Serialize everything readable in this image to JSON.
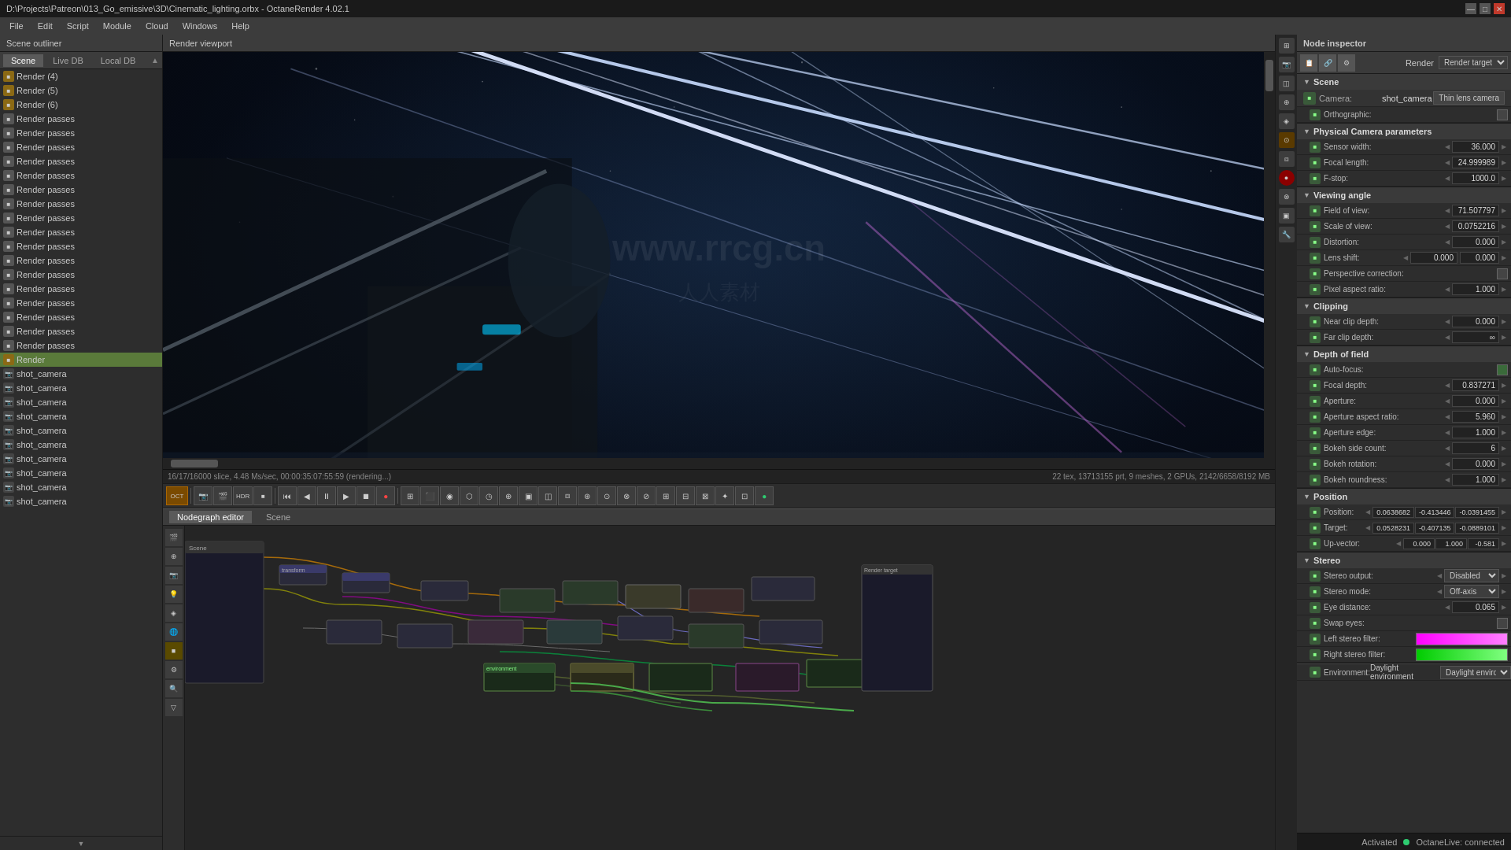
{
  "titlebar": {
    "title": "D:\\Projects\\Patreon\\013_Go_emissive\\3D\\Cinematic_lighting.orbx - OctaneRender 4.02.1",
    "minimize": "—",
    "maximize": "□",
    "close": "✕"
  },
  "menubar": {
    "items": [
      "File",
      "Edit",
      "Script",
      "Module",
      "Cloud",
      "Windows",
      "Help"
    ]
  },
  "left_panel": {
    "header": "Scene outliner",
    "tabs": [
      "Scene",
      "Live DB",
      "Local DB"
    ],
    "active_tab": "Scene",
    "items": [
      {
        "type": "render",
        "name": "Render (4)",
        "level": 1
      },
      {
        "type": "render",
        "name": "Render (5)",
        "level": 1
      },
      {
        "type": "render",
        "name": "Render (6)",
        "level": 1
      },
      {
        "type": "render",
        "name": "Render passes",
        "level": 1
      },
      {
        "type": "render",
        "name": "Render passes",
        "level": 1
      },
      {
        "type": "render",
        "name": "Render passes",
        "level": 1
      },
      {
        "type": "render",
        "name": "Render passes",
        "level": 1
      },
      {
        "type": "render",
        "name": "Render passes",
        "level": 1
      },
      {
        "type": "render",
        "name": "Render passes",
        "level": 1
      },
      {
        "type": "render",
        "name": "Render passes",
        "level": 1
      },
      {
        "type": "render",
        "name": "Render passes",
        "level": 1
      },
      {
        "type": "render",
        "name": "Render passes",
        "level": 1
      },
      {
        "type": "render",
        "name": "Render passes",
        "level": 1
      },
      {
        "type": "render",
        "name": "Render passes",
        "level": 1
      },
      {
        "type": "render",
        "name": "Render passes",
        "level": 1
      },
      {
        "type": "render",
        "name": "Render passes",
        "level": 1
      },
      {
        "type": "render",
        "name": "Render passes",
        "level": 1
      },
      {
        "type": "render",
        "name": "Render passes",
        "level": 1
      },
      {
        "type": "render",
        "name": "Render passes",
        "level": 1
      },
      {
        "type": "render",
        "name": "Render passes",
        "level": 1
      },
      {
        "type": "render",
        "name": "Render passes",
        "level": 1
      },
      {
        "type": "render",
        "name": "Render",
        "level": 1,
        "selected": true
      },
      {
        "type": "camera",
        "name": "shot_camera",
        "level": 1
      },
      {
        "type": "camera",
        "name": "shot_camera",
        "level": 1
      },
      {
        "type": "camera",
        "name": "shot_camera",
        "level": 1
      },
      {
        "type": "camera",
        "name": "shot_camera",
        "level": 1
      },
      {
        "type": "camera",
        "name": "shot_camera",
        "level": 1
      },
      {
        "type": "camera",
        "name": "shot_camera",
        "level": 1
      },
      {
        "type": "camera",
        "name": "shot_camera",
        "level": 1
      },
      {
        "type": "camera",
        "name": "shot_camera",
        "level": 1
      },
      {
        "type": "camera",
        "name": "shot_camera",
        "level": 1
      },
      {
        "type": "camera",
        "name": "shot_camera",
        "level": 1
      },
      {
        "type": "camera",
        "name": "shot_camera",
        "level": 1
      }
    ]
  },
  "render_viewport": {
    "header": "Render viewport",
    "status_left": "16/17/16000 slice, 4.48 Ms/sec, 00:00:35:07:55:59 (rendering...)",
    "status_right": "22 tex, 13713155 prt, 9 meshes, 2 GPUs, 2142/6658/8192 MB"
  },
  "render_toolbar": {
    "time_display": "16/17/16000",
    "buttons": [
      "play_back",
      "prev_frame",
      "play_pause",
      "next_frame",
      "stop",
      "record",
      "camera",
      "render",
      "pause",
      "settings1",
      "settings2",
      "settings3",
      "settings4",
      "settings5",
      "timeline",
      "curve",
      "graph",
      "transform1",
      "transform2",
      "snap",
      "grid",
      "viewport_options",
      "color",
      "indicator"
    ]
  },
  "nodegraph": {
    "header": "Nodegraph editor",
    "tabs": [
      "Nodegraph editor",
      "Scene"
    ]
  },
  "node_inspector": {
    "header": "Node inspector",
    "render_label": "Render",
    "render_target_label": "Render target",
    "render_target_value": "Render target",
    "scene_section": {
      "title": "Scene",
      "camera_label": "Camera:",
      "camera_value": "shot_camera",
      "camera_type": "Thin lens camera",
      "orthographic_label": "Orthographic:"
    },
    "physical_camera": {
      "title": "Physical Camera parameters",
      "sensor_width_label": "Sensor width:",
      "sensor_width_value": "36.000",
      "focal_length_label": "Focal length:",
      "focal_length_value": "24.999989",
      "fstop_label": "F-stop:",
      "fstop_value": "1000.0"
    },
    "viewing_angle": {
      "title": "Viewing angle",
      "fov_label": "Field of view:",
      "fov_value": "71.507797",
      "sov_label": "Scale of view:",
      "sov_value": "0.0752216",
      "distortion_label": "Distortion:",
      "distortion_value": "0.000",
      "lens_shift_label": "Lens shift:",
      "lens_shift_value1": "0.000",
      "lens_shift_value2": "0.000",
      "perspective_label": "Perspective correction:",
      "pixel_aspect_label": "Pixel aspect ratio:",
      "pixel_aspect_value": "1.000"
    },
    "clipping": {
      "title": "Clipping",
      "near_clip_label": "Near clip depth:",
      "near_clip_value": "0.000",
      "far_clip_label": "Far clip depth:",
      "far_clip_value": "∞"
    },
    "depth_of_field": {
      "title": "Depth of field",
      "autofocus_label": "Auto-focus:",
      "focal_depth_label": "Focal depth:",
      "focal_depth_value": "0.837271",
      "aperture_label": "Aperture:",
      "aperture_value": "0.000",
      "aperture_aspect_label": "Aperture aspect ratio:",
      "aperture_aspect_value": "5.960",
      "aperture_edge_label": "Aperture edge:",
      "aperture_edge_value": "1.000",
      "bokeh_side_label": "Bokeh side count:",
      "bokeh_side_value": "6",
      "bokeh_rotation_label": "Bokeh rotation:",
      "bokeh_rotation_value": "0.000",
      "bokeh_roundness_label": "Bokeh roundness:",
      "bokeh_roundness_value": "1.000"
    },
    "position": {
      "title": "Position",
      "pos_label": "Position:",
      "pos_x": "0.0638682",
      "pos_y": "-0.413446",
      "pos_z": "-0.0391455",
      "target_label": "Target:",
      "target_x": "0.0528231",
      "target_y": "-0.407135",
      "target_z": "-0.0889101",
      "up_label": "Up-vector:",
      "up_x": "0.000",
      "up_y": "1.000",
      "up_z": "-0.581"
    },
    "stereo": {
      "title": "Stereo",
      "output_label": "Stereo output:",
      "output_value": "Disabled",
      "mode_label": "Stereo mode:",
      "mode_value": "Off-axis",
      "eye_dist_label": "Eye distance:",
      "eye_dist_value": "0.065",
      "swap_label": "Swap eyes:",
      "left_filter_label": "Left stereo filter:",
      "right_filter_label": "Right stereo filter:"
    },
    "environment": {
      "label": "Environment:",
      "env_name": "Daylight environment",
      "env_type": "Daylight environment"
    }
  },
  "statusbar": {
    "activated": "Activated",
    "octanelive": "OctaneLive: connected"
  },
  "colors": {
    "accent": "#5a7a3a",
    "selected": "#4a6a9a",
    "render_selected": "#5a7a3a",
    "section_bg": "#3a3a3a"
  }
}
